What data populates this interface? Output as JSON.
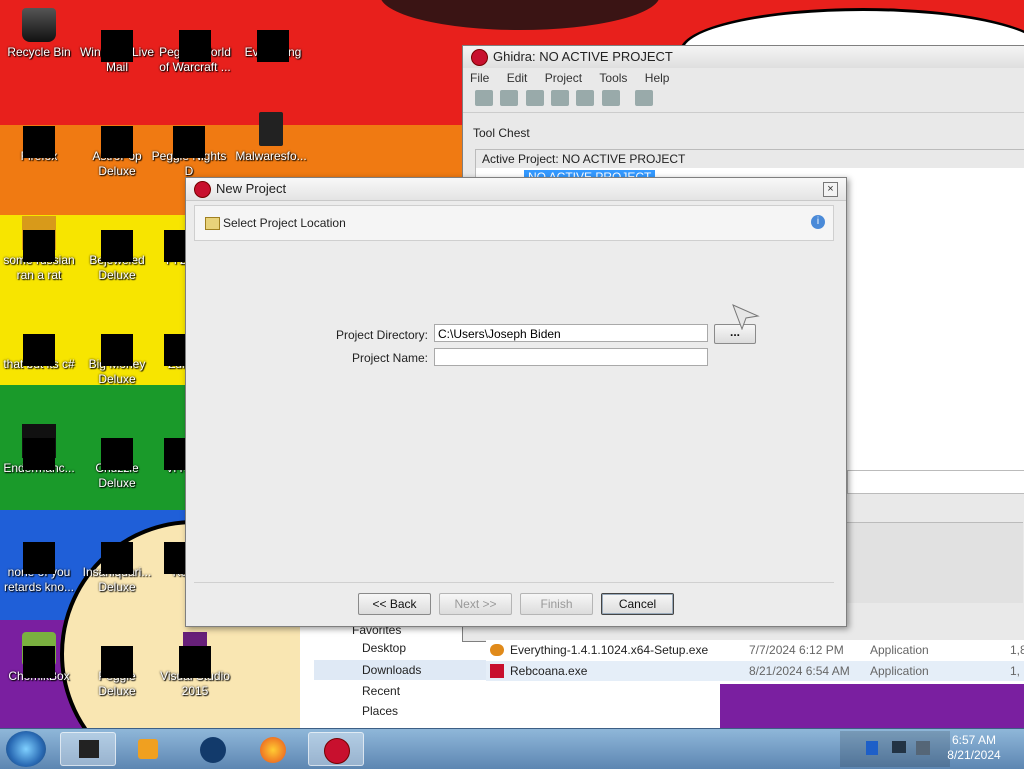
{
  "desktop": {
    "icons": [
      {
        "label": "Recycle Bin"
      },
      {
        "label": "Windows Live Mail"
      },
      {
        "label": "Peggle World of Warcraft ..."
      },
      {
        "label": "Everything"
      },
      {
        "label": "Firefox"
      },
      {
        "label": "AstroPop Deluxe"
      },
      {
        "label": "Peggle Nights D"
      },
      {
        "label": "Malwaresfo..."
      },
      {
        "label": "some russian ran a rat"
      },
      {
        "label": "Bejeweled Deluxe"
      },
      {
        "label": "Pl Ze"
      },
      {
        "label": "that but its c#"
      },
      {
        "label": "Big Money Deluxe"
      },
      {
        "label": "Zum"
      },
      {
        "label": "Endermanc..."
      },
      {
        "label": "Chuzzle Deluxe"
      },
      {
        "label": "Vi Ke"
      },
      {
        "label": "none of you retards kno..."
      },
      {
        "label": "Insaniquari... Deluxe"
      },
      {
        "label": "Ke"
      },
      {
        "label": "ChomikBox"
      },
      {
        "label": "Peggle Deluxe"
      },
      {
        "label": "Visual Studio 2015"
      }
    ]
  },
  "ghidra": {
    "title": "Ghidra: NO ACTIVE PROJECT",
    "menu": [
      "File",
      "Edit",
      "Project",
      "Tools",
      "Help"
    ],
    "tool_chest": "Tool Chest",
    "active_project": "Active Project: NO ACTIVE PROJECT",
    "tree_item": "NO ACTIVE PROJECT"
  },
  "dialog": {
    "title": "New Project",
    "header": "Select Project Location",
    "dir_label": "Project Directory:",
    "dir_value": "C:\\Users\\Joseph Biden",
    "browse": "...",
    "name_label": "Project Name:",
    "name_value": "",
    "back": "<< Back",
    "next": "Next >>",
    "finish": "Finish",
    "cancel": "Cancel"
  },
  "explorer": {
    "nav": [
      "Favorites",
      "Desktop",
      "Downloads",
      "Recent Places"
    ],
    "files": [
      {
        "name": "Everything-1.4.1.1024.x64-Setup.exe",
        "date": "7/7/2024 6:12 PM",
        "type": "Application",
        "size": "1,8"
      },
      {
        "name": "Rebcoana.exe",
        "date": "8/21/2024 6:54 AM",
        "type": "Application",
        "size": "1,"
      }
    ]
  },
  "taskbar": {
    "time": "6:57 AM",
    "date": "8/21/2024"
  }
}
